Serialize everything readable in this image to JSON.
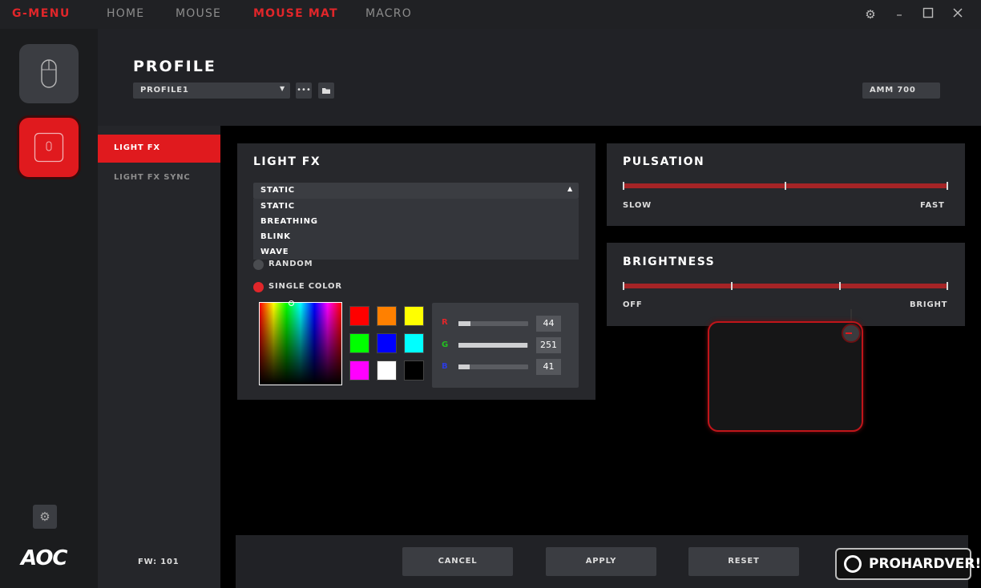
{
  "app": {
    "brand": "G-MENU"
  },
  "nav": [
    {
      "label": "HOME"
    },
    {
      "label": "MOUSE"
    },
    {
      "label": "MOUSE MAT"
    },
    {
      "label": "MACRO"
    }
  ],
  "window": {
    "settings_icon": "gear-icon",
    "minimize_icon": "minimize-icon",
    "maximize_icon": "maximize-icon",
    "close_icon": "close-icon"
  },
  "leftbar": {
    "logo": "AOC",
    "devices": [
      {
        "icon": "mouse-icon"
      },
      {
        "icon": "mousepad-icon"
      }
    ]
  },
  "profile": {
    "title": "PROFILE",
    "selected": "PROFILE1",
    "model": "AMM 700"
  },
  "submenu": {
    "items": [
      {
        "label": "LIGHT FX"
      },
      {
        "label": "LIGHT FX SYNC"
      }
    ],
    "firmware": "FW: 101"
  },
  "lightfx": {
    "title": "LIGHT FX",
    "selected": "STATIC",
    "options": [
      "STATIC",
      "BREATHING",
      "BLINK",
      "WAVE"
    ],
    "color_modes": [
      {
        "label": "RANDOM"
      },
      {
        "label": "SINGLE COLOR"
      }
    ],
    "swatches": [
      "#ff0000",
      "#ff8000",
      "#ffff00",
      "#00ff00",
      "#0000ff",
      "#00ffff",
      "#ff00ff",
      "#ffffff",
      "#000000"
    ],
    "rgb": [
      {
        "label": "R",
        "value": "44",
        "color": "#e0262a"
      },
      {
        "label": "G",
        "value": "251",
        "color": "#22c21f"
      },
      {
        "label": "B",
        "value": "41",
        "color": "#2b3bdf"
      }
    ]
  },
  "pulsation": {
    "title": "PULSATION",
    "min_label": "SLOW",
    "max_label": "FAST"
  },
  "brightness": {
    "title": "BRIGHTNESS",
    "min_label": "OFF",
    "max_label": "BRIGHT"
  },
  "actions": {
    "cancel": "CANCEL",
    "apply": "APPLY",
    "reset": "RESET"
  },
  "watermark": {
    "text": "PROHARDVER!"
  }
}
